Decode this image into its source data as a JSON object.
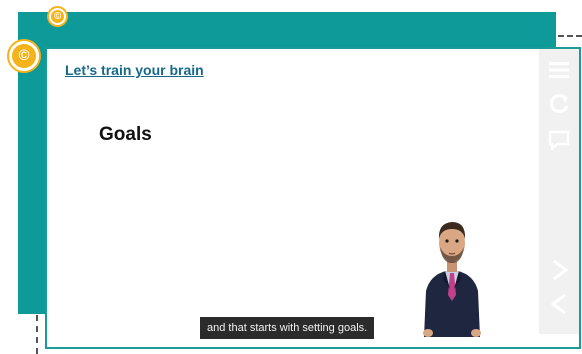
{
  "slide": {
    "title": "Let’s train your brain",
    "heading": "Goals"
  },
  "caption": {
    "text": "and that starts with setting goals."
  },
  "badges": {
    "small": "©",
    "large": "©"
  },
  "sidebar": {
    "buttons": [
      {
        "icon": "menu-icon"
      },
      {
        "icon": "replay-icon"
      },
      {
        "icon": "transcript-icon"
      },
      {
        "icon": "next-icon"
      },
      {
        "icon": "previous-icon"
      }
    ]
  },
  "colors": {
    "teal": "#0e9a98",
    "badge": "#f5b21b",
    "title_link": "#17698a",
    "caption_bg": "#2b2b2b"
  }
}
